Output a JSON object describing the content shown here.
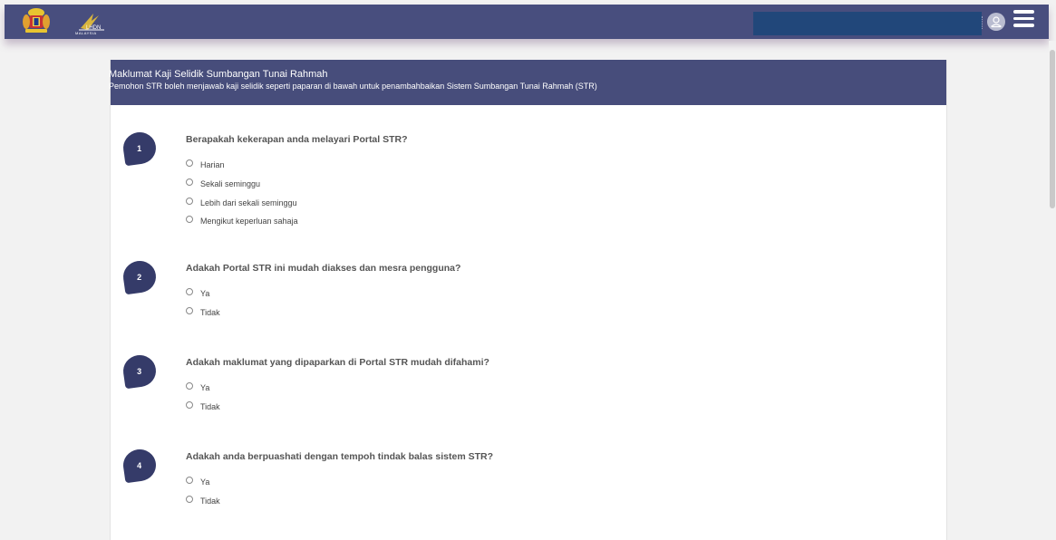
{
  "header": {
    "crest_icon": "malaysia-coat-of-arms-icon",
    "logo_text": "LHDN",
    "logo_subtext": "MALAYSIA",
    "search_value": "",
    "user_icon": "user-icon",
    "menu_icon": "hamburger-menu-icon"
  },
  "survey": {
    "title": "Maklumat Kaji Selidik Sumbangan Tunai Rahmah",
    "subtitle": "Pemohon STR boleh menjawab kaji selidik seperti paparan di bawah untuk penambahbaikan Sistem Sumbangan Tunai Rahmah (STR)",
    "questions": [
      {
        "number": "1",
        "text": "Berapakah kekerapan anda melayari Portal STR?",
        "options": [
          "Harian",
          "Sekali seminggu",
          "Lebih dari sekali seminggu",
          "Mengikut keperluan sahaja"
        ]
      },
      {
        "number": "2",
        "text": "Adakah Portal STR ini mudah diakses dan mesra pengguna?",
        "options": [
          "Ya",
          "Tidak"
        ]
      },
      {
        "number": "3",
        "text": "Adakah maklumat yang dipaparkan di Portal STR mudah difahami?",
        "options": [
          "Ya",
          "Tidak"
        ]
      },
      {
        "number": "4",
        "text": "Adakah anda berpuashati dengan tempoh tindak balas sistem STR?",
        "options": [
          "Ya",
          "Tidak"
        ]
      }
    ]
  },
  "colors": {
    "navbar": "#484e7e",
    "card_header": "#474d7b",
    "badge": "#353b69",
    "search_box": "#21477a"
  }
}
